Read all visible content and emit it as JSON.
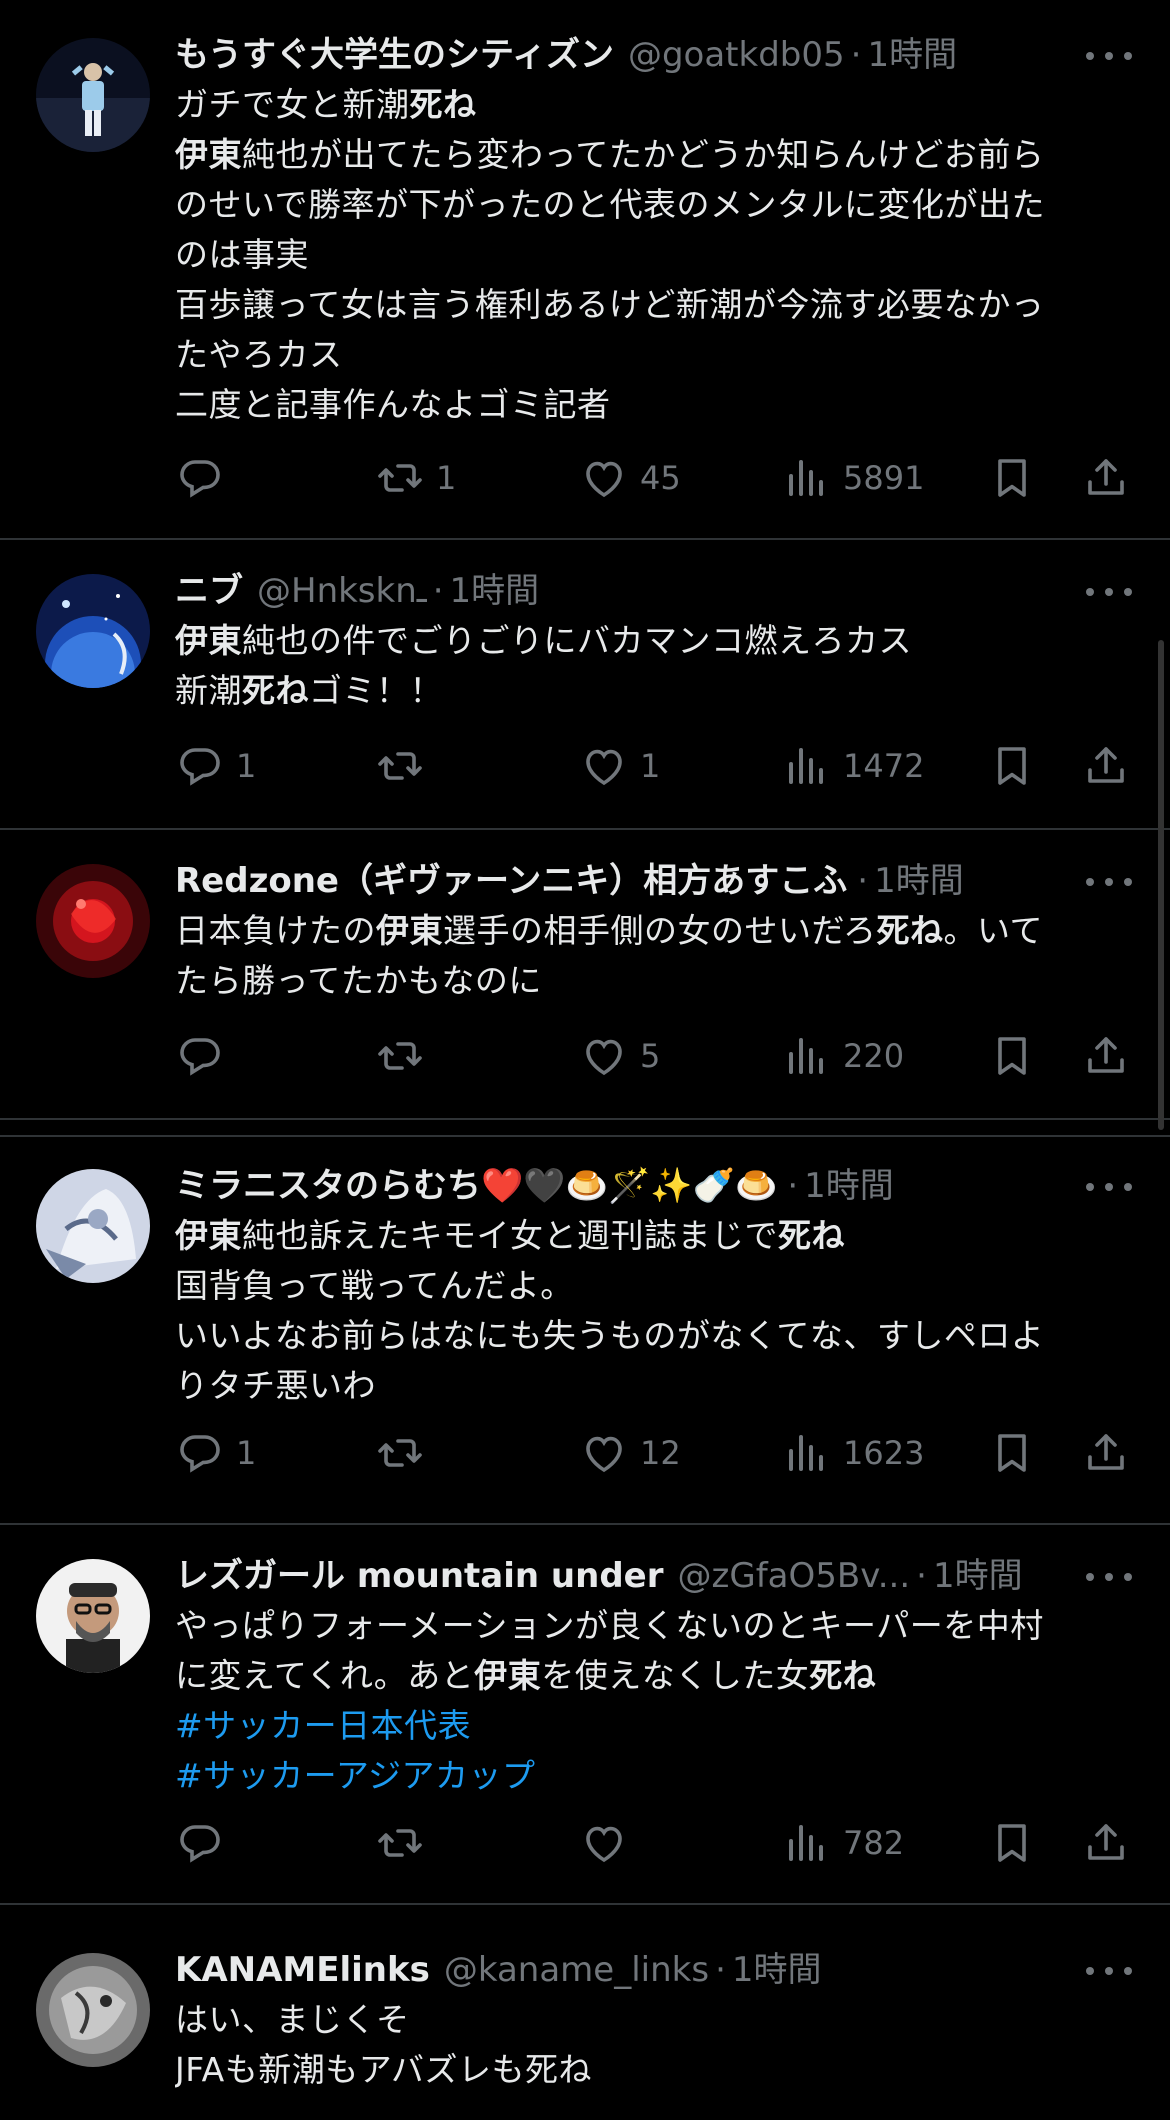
{
  "tweets": [
    {
      "name": "もうすぐ大学生のシティズン",
      "handle": "@goatkdb05",
      "time": "1時間",
      "lines": [
        [
          {
            "t": "ガチで女と新潮"
          },
          {
            "t": "死ね",
            "b": true
          }
        ],
        [
          {
            "t": "伊東",
            "b": true
          },
          {
            "t": "純也が出てたら変わってたかどうか知らんけどお前ら"
          }
        ],
        [
          {
            "t": "のせいで勝率が下がったのと代表のメンタルに変化が出た"
          }
        ],
        [
          {
            "t": "のは事実"
          }
        ],
        [
          {
            "t": "百歩譲って女は言う権利あるけど新潮が今流す必要なかっ"
          }
        ],
        [
          {
            "t": "たやろカス"
          }
        ],
        [
          {
            "t": "二度と記事作んなよゴミ記者"
          }
        ]
      ],
      "replies": "",
      "retweets": "1",
      "likes": "45",
      "views": "5891"
    },
    {
      "name": "ニブ",
      "handle": "@Hnksknـ",
      "time": "1時間",
      "lines": [
        [
          {
            "t": "伊東",
            "b": true
          },
          {
            "t": "純也の件でごりごりにバカマンコ燃えろカス"
          }
        ],
        [
          {
            "t": "新潮"
          },
          {
            "t": "死ね",
            "b": true
          },
          {
            "t": "ゴミ！！"
          }
        ]
      ],
      "replies": "1",
      "retweets": "",
      "likes": "1",
      "views": "1472"
    },
    {
      "name": "Redzone（ギヴァーンニキ）相方あすこふ",
      "handle": "",
      "time": "1時間",
      "lines": [
        [
          {
            "t": "日本負けたの"
          },
          {
            "t": "伊東",
            "b": true
          },
          {
            "t": "選手の相手側の女のせいだろ"
          },
          {
            "t": "死ね",
            "b": true
          },
          {
            "t": "。いて"
          }
        ],
        [
          {
            "t": "たら勝ってたかもなのに"
          }
        ]
      ],
      "replies": "",
      "retweets": "",
      "likes": "5",
      "views": "220"
    },
    {
      "name": "ミラニスタのらむち❤️🖤🍮🪄✨🍼🍮",
      "handle": "",
      "time": "1時間",
      "lines": [
        [
          {
            "t": "伊東",
            "b": true
          },
          {
            "t": "純也訴えたキモイ女と週刊誌まじで"
          },
          {
            "t": "死ね",
            "b": true
          }
        ],
        [
          {
            "t": "国背負って戦ってんだよ。"
          }
        ],
        [
          {
            "t": "いいよなお前らはなにも失うものがなくてな、すしペロよ"
          }
        ],
        [
          {
            "t": "りタチ悪いわ"
          }
        ]
      ],
      "replies": "1",
      "retweets": "",
      "likes": "12",
      "views": "1623"
    },
    {
      "name": "レズガール mountain under",
      "handle": "@zGfaO5Bv...",
      "time": "1時間",
      "lines": [
        [
          {
            "t": "やっぱりフォーメーションが良くないのとキーパーを中村"
          }
        ],
        [
          {
            "t": "に変えてくれ。あと"
          },
          {
            "t": "伊東",
            "b": true
          },
          {
            "t": "を使えなくした女"
          },
          {
            "t": "死ね",
            "b": true
          }
        ],
        [
          {
            "t": "#サッカー日本代表",
            "tag": true
          }
        ],
        [
          {
            "t": "#サッカーアジアカップ",
            "tag": true
          }
        ]
      ],
      "replies": "",
      "retweets": "",
      "likes": "",
      "views": "782"
    },
    {
      "name": "KANAMElinks",
      "handle": "@kaname_links",
      "time": "1時間",
      "lines": [
        [
          {
            "t": "はい、まじくそ"
          }
        ],
        [
          {
            "t": "JFAも新潮もアバズレも死ね"
          }
        ]
      ]
    }
  ],
  "separator": "·",
  "colors": {
    "background": "#000000",
    "text": "#e7e9ea",
    "muted": "#71767b",
    "hashtag": "#1d9bf0",
    "divider": "#2f3336"
  },
  "icons": [
    "reply-icon",
    "retweet-icon",
    "like-icon",
    "views-icon",
    "bookmark-icon",
    "share-icon",
    "more-icon"
  ]
}
